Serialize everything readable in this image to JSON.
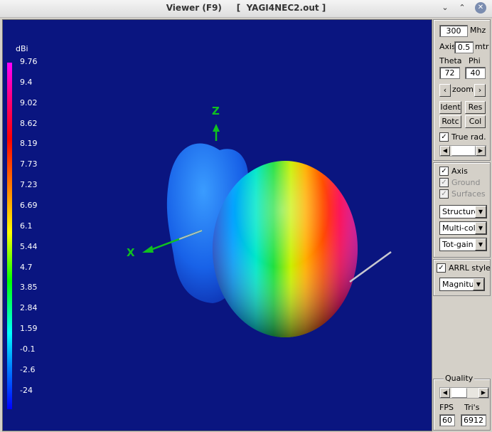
{
  "window": {
    "title": "Viewer (F9)     [  YAGI4NEC2.out ]",
    "minimize_glyph": "⌄",
    "restore_glyph": "⌃",
    "close_glyph": "✕"
  },
  "legend": {
    "unit": "dBi",
    "labels": [
      "9.76",
      "9.4",
      "9.02",
      "8.62",
      "8.19",
      "7.73",
      "7.23",
      "6.69",
      "6.1",
      "5.44",
      "4.7",
      "3.85",
      "2.84",
      "1.59",
      "-0.1",
      "-2.6",
      "-24"
    ]
  },
  "axes": {
    "x_label": "X",
    "z_label": "Z"
  },
  "panel": {
    "freq_value": "300",
    "freq_unit": "Mhz",
    "axis_label": "Axis",
    "axis_value": "0.5",
    "axis_unit": "mtr",
    "theta_label": "Theta",
    "phi_label": "Phi",
    "theta_value": "72",
    "phi_value": "40",
    "zoom_left": "‹",
    "zoom_label": "zoom",
    "zoom_right": "›",
    "ident_label": "Ident",
    "res_label": "Res",
    "rotc_label": "Rotc",
    "col_label": "Col",
    "true_rad_label": "True rad.",
    "true_rad_checked": "✓",
    "axis_check_label": "Axis",
    "axis_checked": "✓",
    "ground_label": "Ground",
    "ground_checked": "✓",
    "surfaces_label": "Surfaces",
    "surfaces_checked": "✓",
    "structure_select": "Structure",
    "color_select": "Multi-colo",
    "gain_select": "Tot-gain",
    "arrl_label": "ARRL style",
    "arrl_checked": "✓",
    "magnitude_select": "Magnituc",
    "quality_label": "Quality",
    "fps_label": "FPS",
    "tris_label": "Tri's",
    "fps_value": "60",
    "tris_value": "6912",
    "dropdown_glyph": "▼",
    "arrow_left": "◀",
    "arrow_right": "▶"
  }
}
